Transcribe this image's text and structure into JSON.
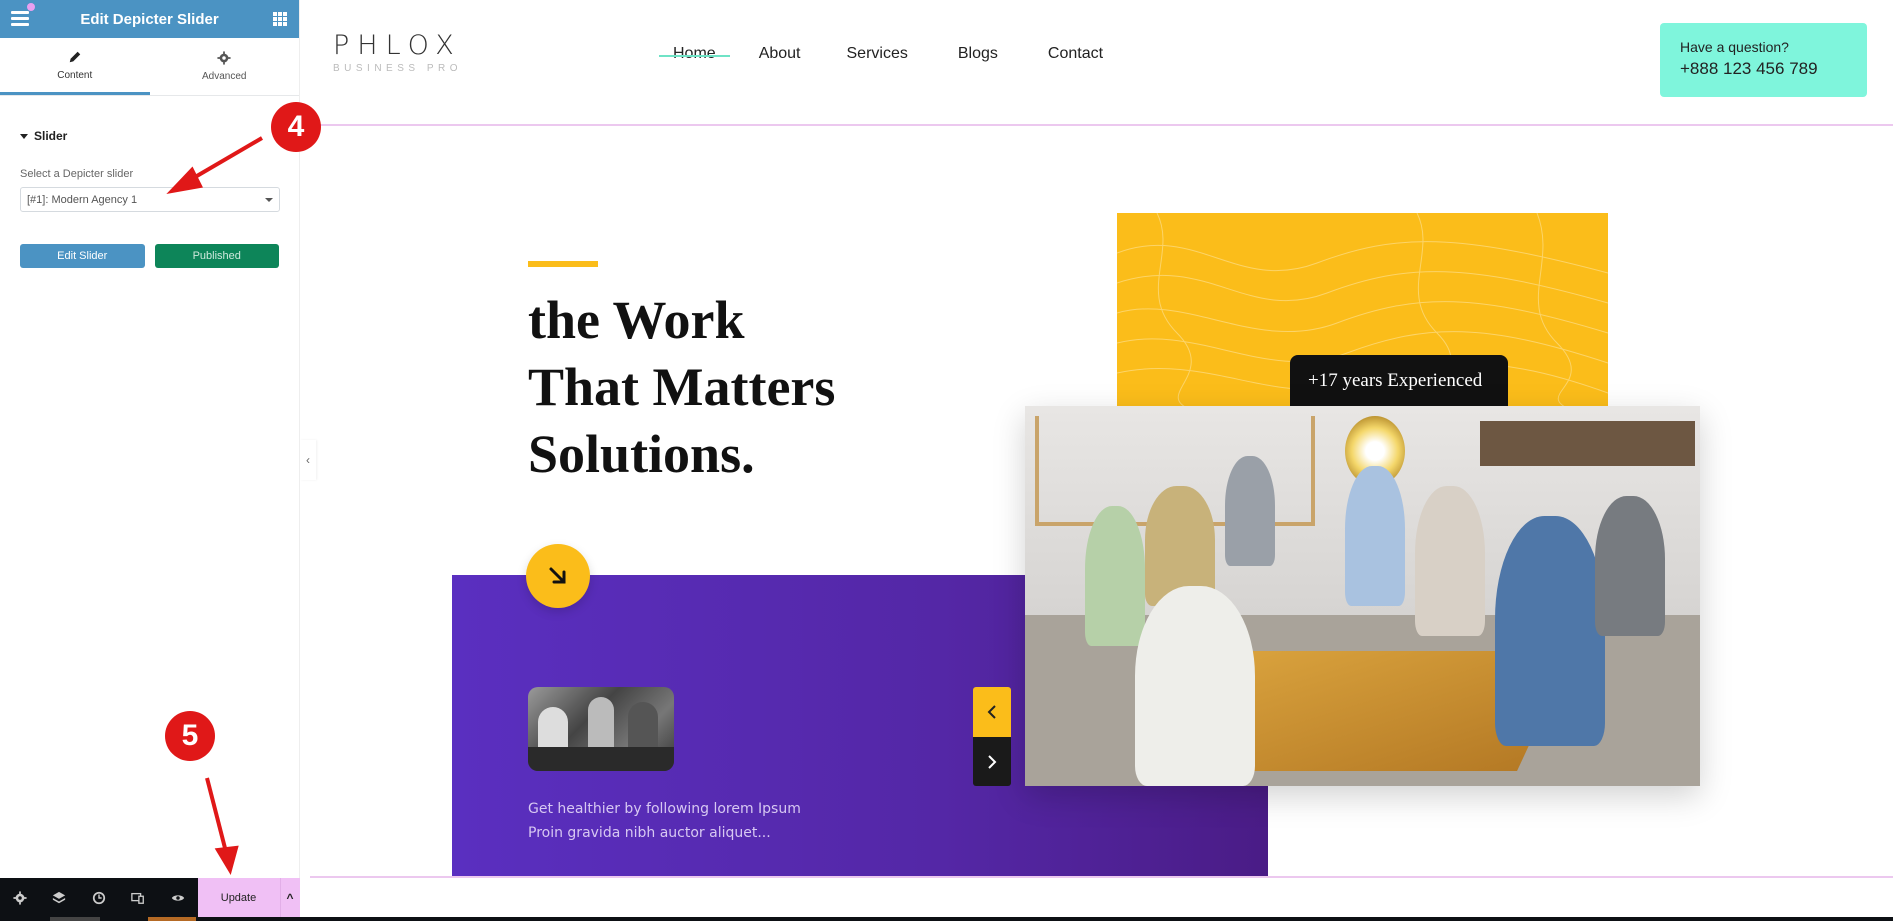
{
  "editor": {
    "panel_title": "Edit Depicter Slider",
    "tabs": [
      {
        "label": "Content",
        "icon": "pencil-icon",
        "active": true
      },
      {
        "label": "Advanced",
        "icon": "gear-icon",
        "active": false
      }
    ],
    "section_title": "Slider",
    "select_label": "Select a Depicter slider",
    "select_value": "[#1]: Modern Agency 1",
    "edit_button": "Edit Slider",
    "published_button": "Published",
    "collapse_icon": "‹",
    "bottom_bar": {
      "icons": [
        "settings-icon",
        "layers-icon",
        "history-icon",
        "responsive-icon",
        "preview-icon"
      ],
      "update_label": "Update",
      "arrow": "^"
    },
    "colors": {
      "header": "#4b93c3",
      "published": "#0d8559",
      "update": "#f0c0f5"
    }
  },
  "site": {
    "logo": {
      "main": "PHLOX",
      "sub": "BUSINESS PRO"
    },
    "nav": [
      "Home",
      "About",
      "Services",
      "Blogs",
      "Contact"
    ],
    "active_nav": "Home",
    "contact": {
      "question": "Have a question?",
      "phone": "+888 123 456 789"
    },
    "hero": {
      "headline_lines": [
        "the Work",
        "That Matters",
        "Solutions."
      ],
      "experience_tag": "+17 years Experienced",
      "blurb_lines": [
        "Get healthier by following lorem Ipsum",
        "Proin gravida nibh auctor aliquet..."
      ]
    },
    "colors": {
      "accent_yellow": "#fbbd1a",
      "purple": "#5427a6",
      "mint": "#7ff5dc"
    }
  },
  "annotations": [
    {
      "number": "4",
      "target": "Select a Depicter slider dropdown"
    },
    {
      "number": "5",
      "target": "Update button"
    }
  ]
}
